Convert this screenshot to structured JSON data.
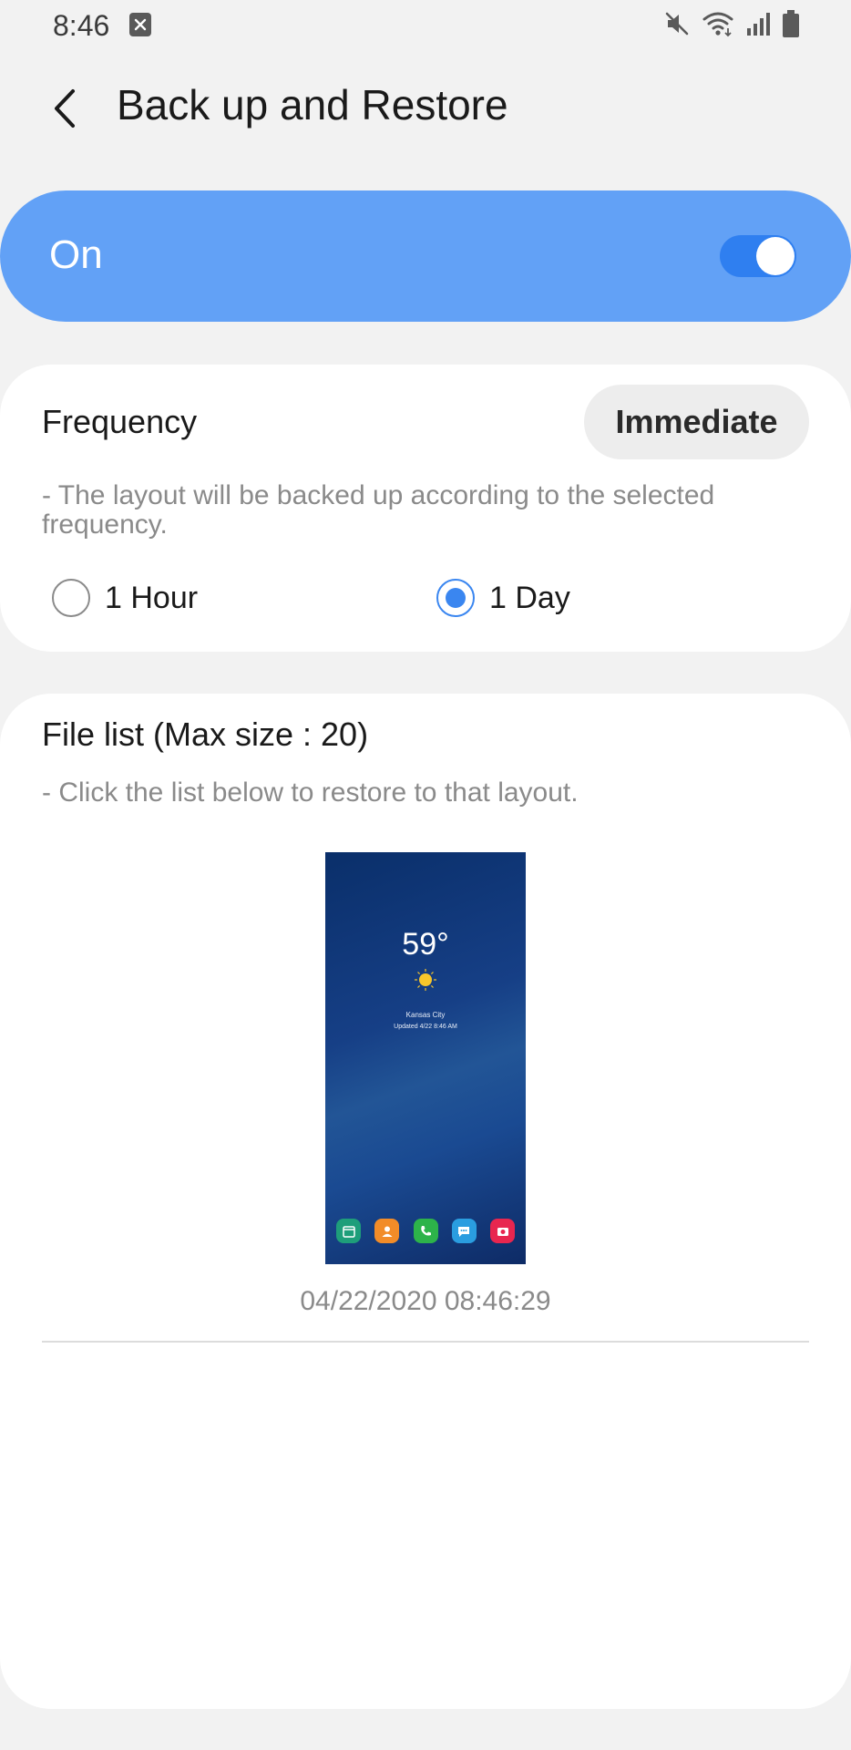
{
  "status_bar": {
    "time": "8:46",
    "icons": [
      "notification-icon",
      "mute-icon",
      "wifi-icon",
      "signal-icon",
      "battery-icon"
    ]
  },
  "header": {
    "title": "Back up and Restore",
    "back_icon": "chevron-left-icon"
  },
  "master_switch": {
    "label": "On",
    "state": "on",
    "accent": "#62a1f6"
  },
  "frequency": {
    "title": "Frequency",
    "immediate_label": "Immediate",
    "description": "- The layout will be backed up according to the selected frequency.",
    "options": [
      {
        "label": "1 Hour",
        "selected": false
      },
      {
        "label": "1 Day",
        "selected": true
      }
    ]
  },
  "file_list": {
    "title": "File list (Max size : 20)",
    "description": "- Click the list below to restore to that layout.",
    "items": [
      {
        "timestamp": "04/22/2020 08:46:29",
        "preview": {
          "temperature": "59°",
          "city": "Kansas City",
          "updated": "Updated 4/22 8:46 AM",
          "dock_apps": [
            "calendar-icon",
            "contacts-icon",
            "phone-icon",
            "messages-icon",
            "camera-icon"
          ]
        }
      }
    ]
  },
  "colors": {
    "accent": "#3a86f0",
    "background": "#f2f2f2",
    "card": "#ffffff"
  }
}
